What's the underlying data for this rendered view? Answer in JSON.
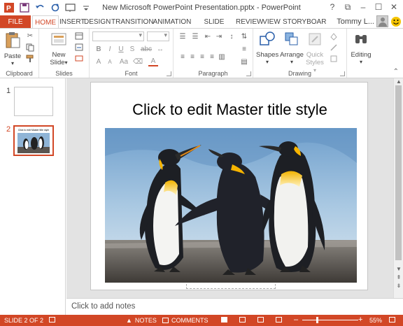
{
  "window": {
    "title": "New Microsoft PowerPoint Presentation.pptx - PowerPoint",
    "controls": [
      "?",
      "⧉",
      "–",
      "☐",
      "✕"
    ]
  },
  "qat_icons": [
    "powerpoint-logo-icon",
    "save-icon",
    "undo-icon",
    "redo-icon",
    "slideshow-icon",
    "customize-icon"
  ],
  "tabs": [
    {
      "label": "FILE"
    },
    {
      "label": "HOME"
    },
    {
      "label": "INSERT"
    },
    {
      "label": "DESIGN"
    },
    {
      "label": "TRANSITION"
    },
    {
      "label": "ANIMATION"
    },
    {
      "label": "SLIDE SHOW"
    },
    {
      "label": "REVIEW"
    },
    {
      "label": "VIEW"
    },
    {
      "label": "STORYBOAR"
    }
  ],
  "user": {
    "name": "Tommy L..."
  },
  "ribbon": {
    "clipboard": {
      "label": "Clipboard",
      "paste": "Paste"
    },
    "slides": {
      "label": "Slides",
      "new_line1": "New",
      "new_line2": "Slide"
    },
    "font": {
      "label": "Font",
      "bold": "B",
      "italic": "I",
      "underline": "U",
      "strike": "S",
      "abc": "abc",
      "grow": "A",
      "shrink": "A",
      "aa": "Aa",
      "color": "A"
    },
    "paragraph": {
      "label": "Paragraph"
    },
    "drawing": {
      "label": "Drawing",
      "shapes": "Shapes",
      "arrange": "Arrange",
      "quick1": "Quick",
      "quick2": "Styles"
    },
    "editing": {
      "label": "Editing"
    }
  },
  "thumbnails": [
    {
      "number": "1",
      "mini_title": ""
    },
    {
      "number": "2",
      "mini_title": "Click to edit Master title style"
    }
  ],
  "slide": {
    "title": "Click to edit Master title style"
  },
  "notes": {
    "placeholder": "Click to add notes"
  },
  "status": {
    "slide_info": "SLIDE 2 OF 2",
    "notes": "NOTES",
    "comments": "COMMENTS",
    "zoom": "55%"
  },
  "colors": {
    "accent": "#d24726"
  }
}
